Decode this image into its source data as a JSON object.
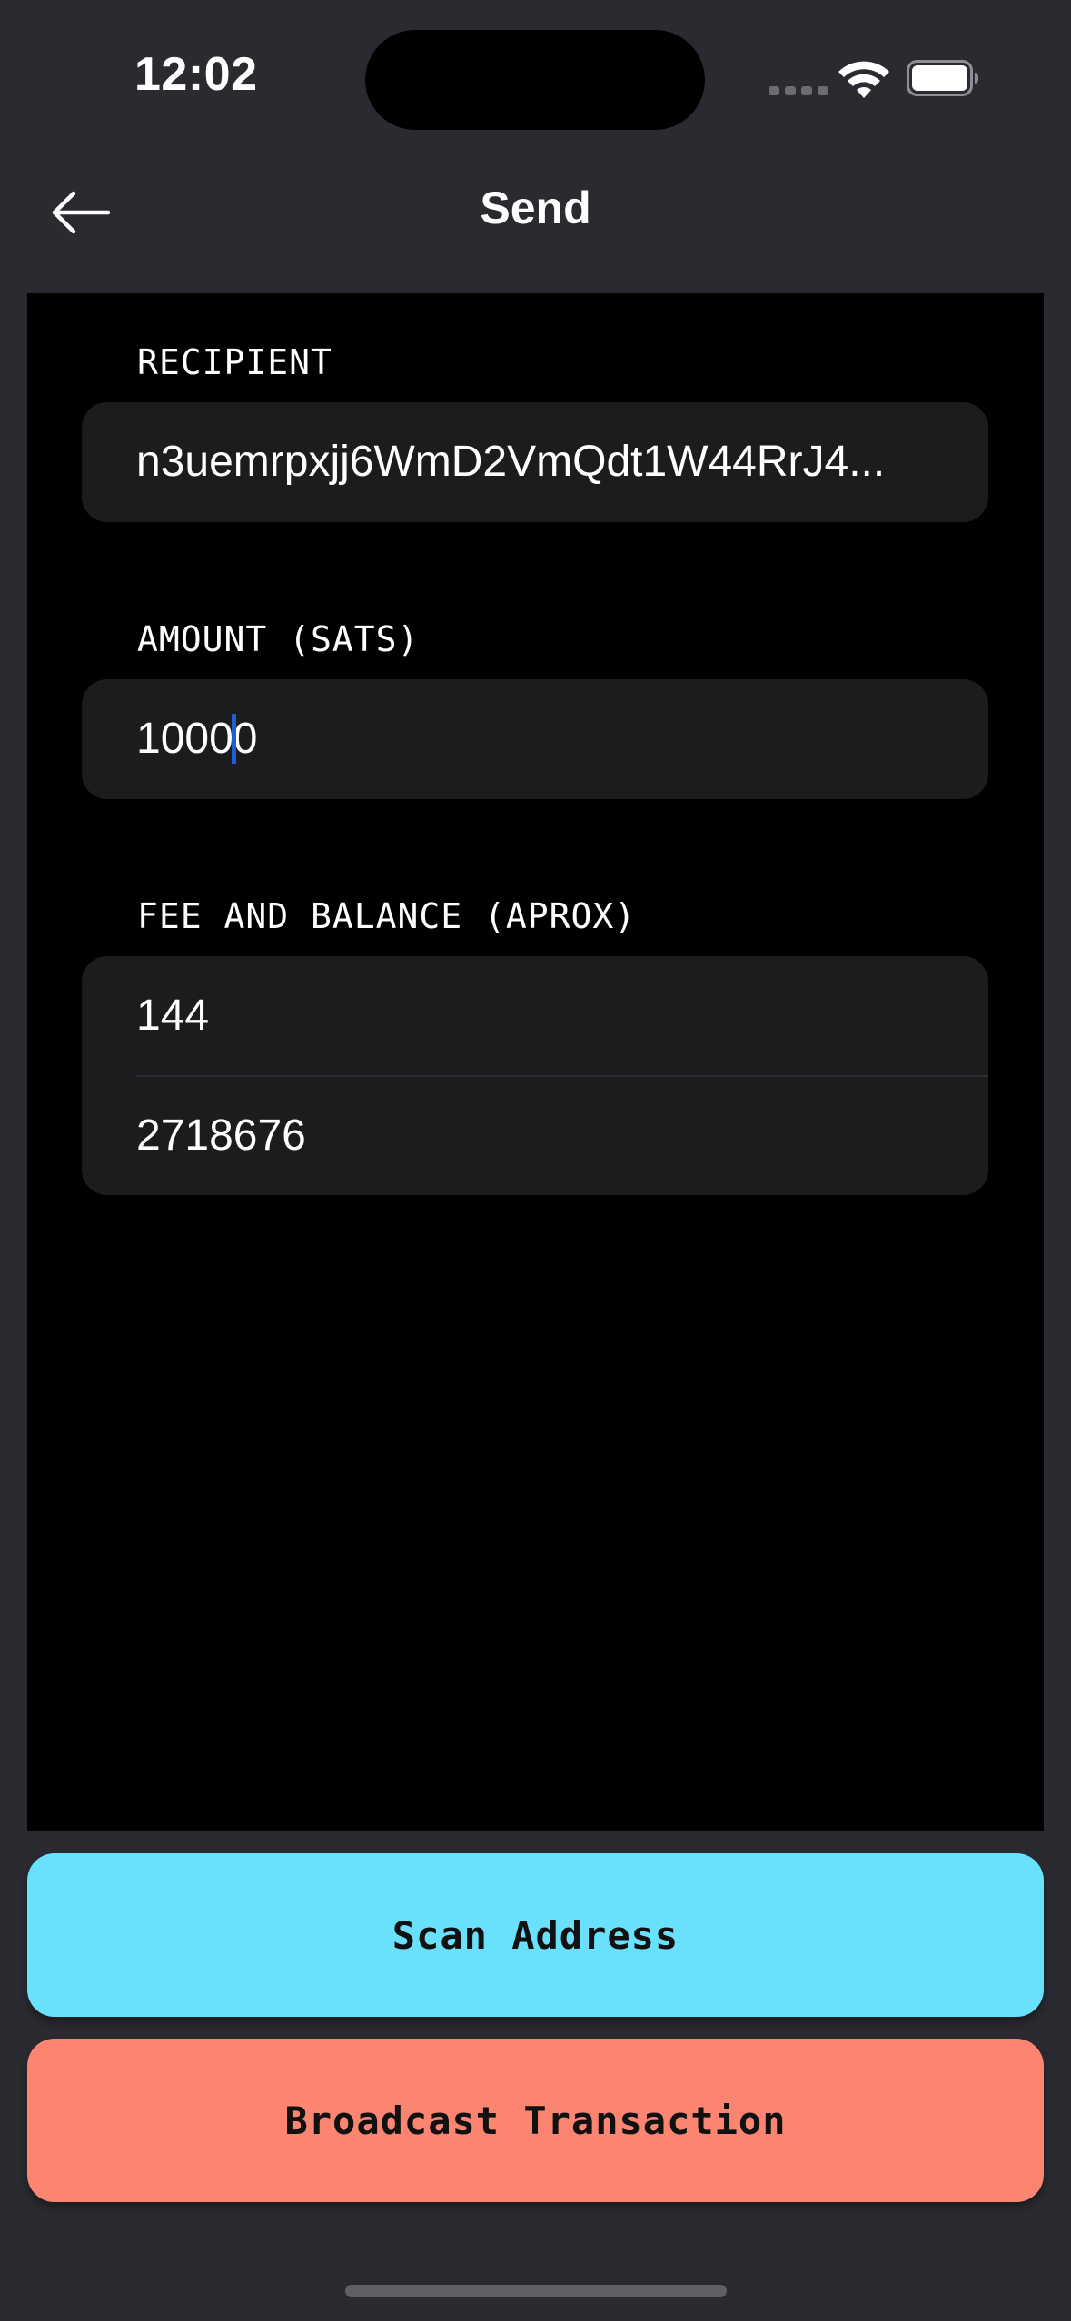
{
  "status_bar": {
    "time": "12:02"
  },
  "nav": {
    "title": "Send"
  },
  "recipient": {
    "label": "RECIPIENT",
    "value": "n3uemrpxjj6WmD2VmQdt1W44RrJ4..."
  },
  "amount": {
    "label": "AMOUNT (SATS)",
    "value_before_caret": "1000",
    "value_after_caret": "0"
  },
  "fee_balance": {
    "label": "FEE AND BALANCE (APROX)",
    "fee": "144",
    "balance": "2718676"
  },
  "buttons": {
    "scan_label": "Scan Address",
    "broadcast_label": "Broadcast Transaction"
  },
  "colors": {
    "background": "#2a2b30",
    "content_background": "#000000",
    "field_background": "#1c1c1e",
    "scan_button": "#6ae1fc",
    "broadcast_button": "#fc8571",
    "caret": "#1e5fd6"
  }
}
